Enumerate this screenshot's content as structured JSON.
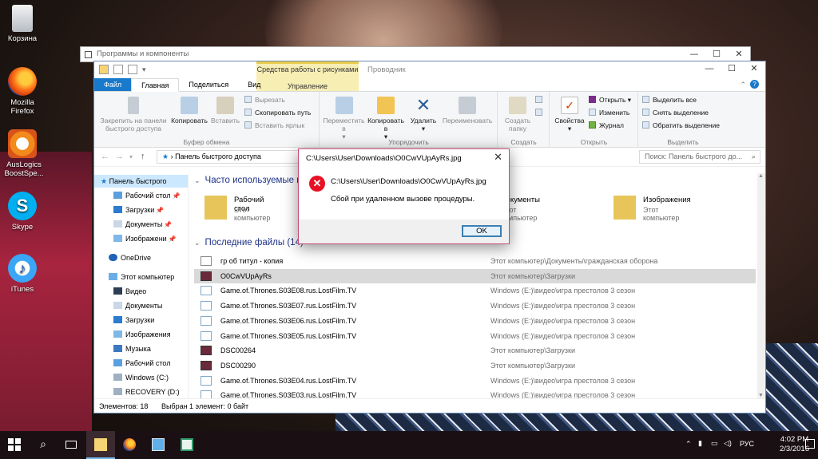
{
  "desktop": {
    "icons": [
      {
        "label": "Корзина",
        "name": "recycle-bin-icon"
      },
      {
        "label": "Mozilla Firefox",
        "name": "firefox-icon"
      },
      {
        "label": "AusLogics BoostSpe...",
        "name": "auslogics-icon"
      },
      {
        "label": "Skype",
        "name": "skype-icon"
      },
      {
        "label": "iTunes",
        "name": "itunes-icon"
      }
    ]
  },
  "back_window": {
    "title": "Программы и компоненты"
  },
  "explorer": {
    "context_tab_group": "Средства работы с рисунками",
    "context_tab": "Управление",
    "app_title": "Проводник",
    "tabs": [
      "Файл",
      "Главная",
      "Поделиться",
      "Вид"
    ],
    "ribbon": {
      "pin_label": "Закрепить на панели быстрого доступа",
      "copy_label": "Копировать",
      "paste_label": "Вставить",
      "cut_label": "Вырезать",
      "copy_path_label": "Скопировать путь",
      "paste_shortcut_label": "Вставить ярлык",
      "group_clipboard": "Буфер обмена",
      "move_to_label": "Переместить в",
      "copy_to_label": "Копировать в",
      "delete_label": "Удалить",
      "rename_label": "Переименовать",
      "group_organize": "Упорядочить",
      "new_folder_label": "Создать папку",
      "group_create": "Создать",
      "properties_label": "Свойства",
      "open_label": "Открыть",
      "edit_label": "Изменить",
      "history_label": "Журнал",
      "group_open": "Открыть",
      "select_all_label": "Выделить все",
      "select_none_label": "Снять выделение",
      "invert_selection_label": "Обратить выделение",
      "group_select": "Выделить"
    },
    "address": "Панель быстрого доступа",
    "search_placeholder": "Поиск: Панель быстрого до...",
    "nav": [
      "Панель быстрого",
      "Рабочий стол",
      "Загрузки",
      "Документы",
      "Изображени",
      "OneDrive",
      "Этот компьютер",
      "Видео",
      "Документы",
      "Загрузки",
      "Изображения",
      "Музыка",
      "Рабочий стол",
      "Windows (C:)",
      "RECOVERY (D:)"
    ],
    "frequent_header": "Часто используемые па",
    "favorites": [
      {
        "name": "Рабочий стол",
        "sub": "Этот компьютер"
      },
      {
        "name": "Документы",
        "sub": "Этот компьютер"
      },
      {
        "name": "Изображения",
        "sub": "Этот компьютер"
      }
    ],
    "recent_header": "Последние файлы (14)",
    "recent_files": [
      {
        "name": "гр об титул - копия",
        "path": "Этот компьютер\\Документы\\гражданская оборона",
        "kind": "doc"
      },
      {
        "name": "O0CwVUpAyRs",
        "path": "Этот компьютер\\Загрузки",
        "kind": "pic",
        "selected": true
      },
      {
        "name": "Game.of.Thrones.S03E08.rus.LostFilm.TV",
        "path": "Windows (E:)\\видео\\игра престолов 3 сезон",
        "kind": "video"
      },
      {
        "name": "Game.of.Thrones.S03E07.rus.LostFilm.TV",
        "path": "Windows (E:)\\видео\\игра престолов 3 сезон",
        "kind": "video"
      },
      {
        "name": "Game.of.Thrones.S03E06.rus.LostFilm.TV",
        "path": "Windows (E:)\\видео\\игра престолов 3 сезон",
        "kind": "video"
      },
      {
        "name": "Game.of.Thrones.S03E05.rus.LostFilm.TV",
        "path": "Windows (E:)\\видео\\игра престолов 3 сезон",
        "kind": "video"
      },
      {
        "name": "DSC00264",
        "path": "Этот компьютер\\Загрузки",
        "kind": "pic"
      },
      {
        "name": "DSC00290",
        "path": "Этот компьютер\\Загрузки",
        "kind": "pic"
      },
      {
        "name": "Game.of.Thrones.S03E04.rus.LostFilm.TV",
        "path": "Windows (E:)\\видео\\игра престолов 3 сезон",
        "kind": "video"
      },
      {
        "name": "Game.of.Thrones.S03E03.rus.LostFilm.TV",
        "path": "Windows (E:)\\видео\\игра престолов 3 сезон",
        "kind": "video"
      }
    ],
    "status_items": "Элементов: 18",
    "status_selected": "Выбран 1 элемент: 0 байт"
  },
  "dialog": {
    "title": "C:\\Users\\User\\Downloads\\O0CwVUpAyRs.jpg",
    "message_path": "C:\\Users\\User\\Downloads\\O0CwVUpAyRs.jpg",
    "message": "Сбой при удаленном вызове процедуры.",
    "ok_label": "OK"
  },
  "taskbar": {
    "language": "РУС",
    "time": "4:02 PM",
    "date": "2/3/2016"
  },
  "colors": {
    "accent": "#1979ca",
    "error": "#e81123",
    "selection": "#cce8ff",
    "context_tab": "#f7eeb4"
  }
}
